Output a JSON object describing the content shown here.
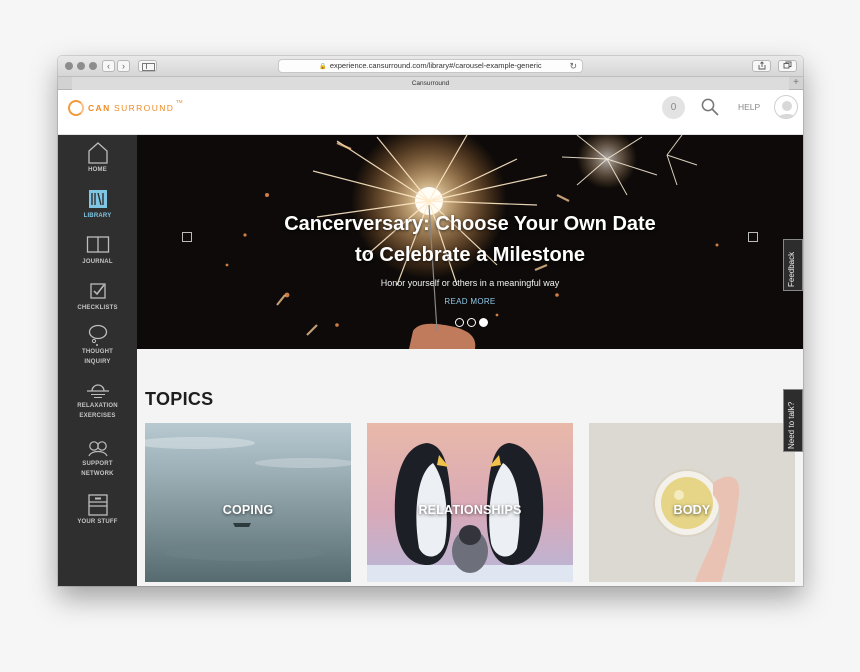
{
  "browser": {
    "url": "experience.cansurround.com/library#/carousel-example-generic",
    "tab_title": "Cansurround",
    "back_icon": "chevron-left-icon",
    "forward_icon": "chevron-right-icon"
  },
  "header": {
    "logo_can": "CAN",
    "logo_surround": "SURROUND",
    "logo_tm": "TM",
    "notification_count": "0",
    "help_label": "HELP",
    "brand_color": "#f08a24"
  },
  "sidebar": {
    "items": [
      {
        "label": "HOME",
        "icon": "home-icon"
      },
      {
        "label": "LIBRARY",
        "icon": "library-icon",
        "active": true
      },
      {
        "label": "JOURNAL",
        "icon": "journal-icon"
      },
      {
        "label": "CHECKLISTS",
        "icon": "checklist-icon"
      },
      {
        "label": "THOUGHT",
        "label2": "INQUIRY",
        "icon": "thought-bubble-icon"
      },
      {
        "label": "RELAXATION",
        "label2": "EXERCISES",
        "icon": "sunset-icon"
      },
      {
        "label": "SUPPORT",
        "label2": "NETWORK",
        "icon": "network-icon"
      },
      {
        "label": "YOUR STUFF",
        "icon": "archive-box-icon"
      }
    ],
    "active_color": "#7fc6e4"
  },
  "hero": {
    "title_line1": "Cancerversary: Choose Your Own Date",
    "title_line2": "to Celebrate a Milestone",
    "subtitle": "Honor yourself or others in a meaningful way",
    "cta": "READ MORE",
    "slides_total": 3,
    "active_slide": 3
  },
  "side_tabs": {
    "feedback": "Feedback",
    "talk": "Need to talk?"
  },
  "topics": {
    "heading": "TOPICS",
    "cards": [
      {
        "label": "COPING"
      },
      {
        "label": "RELATIONSHIPS"
      },
      {
        "label": "BODY"
      }
    ]
  }
}
